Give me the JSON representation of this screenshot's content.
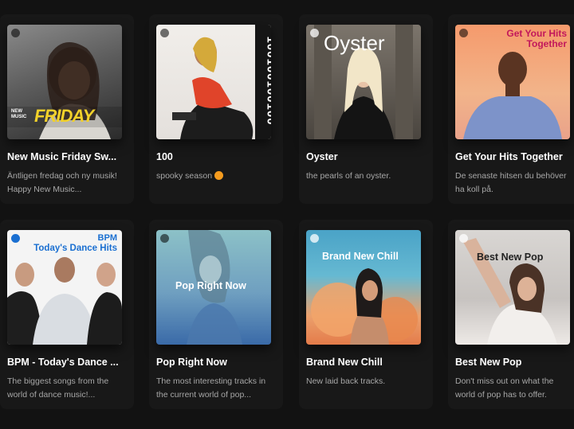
{
  "playlists": [
    {
      "title": "New Music Friday Sw...",
      "description": "Äntligen fredag och ny musik! Happy New Music...",
      "cover_text": "FRIDAY",
      "cover_subtext": "NEW MUSIC",
      "accent": "#f2d12a"
    },
    {
      "title": "100",
      "description": "spooky season",
      "description_icon": "pumpkin-emoji",
      "cover_text": "100100100100",
      "accent": "#e2402a"
    },
    {
      "title": "Oyster",
      "description": "the pearls of an oyster.",
      "cover_text": "Oyster",
      "accent": "#3a3a3a"
    },
    {
      "title": "Get Your Hits Together",
      "description": "De senaste hitsen du behöver ha koll på.",
      "cover_text": "Get Your Hits Together",
      "accent": "#f4a16d"
    },
    {
      "title": "BPM - Today's Dance ...",
      "description": "The biggest songs from the world of dance music!...",
      "cover_text": "BPM",
      "cover_subtext": "Today's Dance Hits",
      "accent": "#1a6fd1"
    },
    {
      "title": "Pop Right Now",
      "description": "The most interesting tracks in the current world of pop...",
      "cover_text": "Pop Right Now",
      "accent": "#7fb3c9"
    },
    {
      "title": "Brand New Chill",
      "description": "New laid back tracks.",
      "cover_text": "Brand New Chill",
      "accent": "#e58a55"
    },
    {
      "title": "Best New Pop",
      "description": "Don't miss out on what the world of pop has to offer.",
      "cover_text": "Best New Pop",
      "accent": "#c7c3c0"
    }
  ]
}
